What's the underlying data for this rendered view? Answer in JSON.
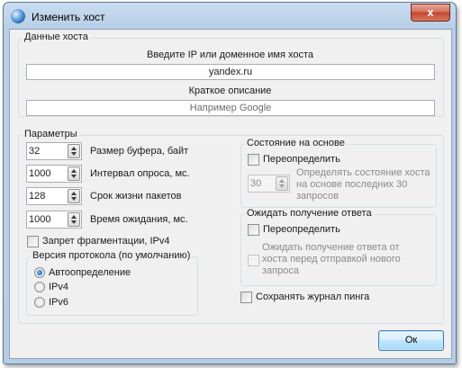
{
  "window": {
    "title": "Изменить хост",
    "close_label": "x"
  },
  "host_data": {
    "group_title": "Данные хоста",
    "address_label": "Введите IP или доменное имя хоста",
    "address_value": "yandex.ru",
    "description_label": "Краткое описание",
    "description_placeholder": "Например Google"
  },
  "parameters": {
    "group_title": "Параметры",
    "fields": [
      {
        "value": "32",
        "label": "Размер буфера, байт"
      },
      {
        "value": "1000",
        "label": "Интервал опроса, мс."
      },
      {
        "value": "128",
        "label": "Срок жизни пакетов"
      },
      {
        "value": "1000",
        "label": "Время ожидания, мс."
      }
    ],
    "fragmentation_label": "Запрет фрагментации, IPv4",
    "fragmentation_checked": false
  },
  "protocol": {
    "group_title": "Версия протокола (по умолчанию)",
    "options": [
      {
        "label": "Автоопределение",
        "checked": true
      },
      {
        "label": "IPv4",
        "checked": false
      },
      {
        "label": "IPv6",
        "checked": false
      }
    ]
  },
  "state": {
    "group_title": "Состояние на основе",
    "override_label": "Переопределить",
    "override_checked": false,
    "count_value": "30",
    "description": [
      "Определять состояние хоста",
      "на основе последних 30",
      "запросов"
    ]
  },
  "wait": {
    "group_title": "Ожидать получение ответа",
    "override_label": "Переопределить",
    "override_checked": false,
    "option_lines": [
      "Ожидать получение ответа от",
      "хоста перед отправкой нового",
      "запроса"
    ],
    "option_checked": false
  },
  "save_log": {
    "label": "Сохранять журнал пинга",
    "checked": false
  },
  "ok_label": "Ок"
}
